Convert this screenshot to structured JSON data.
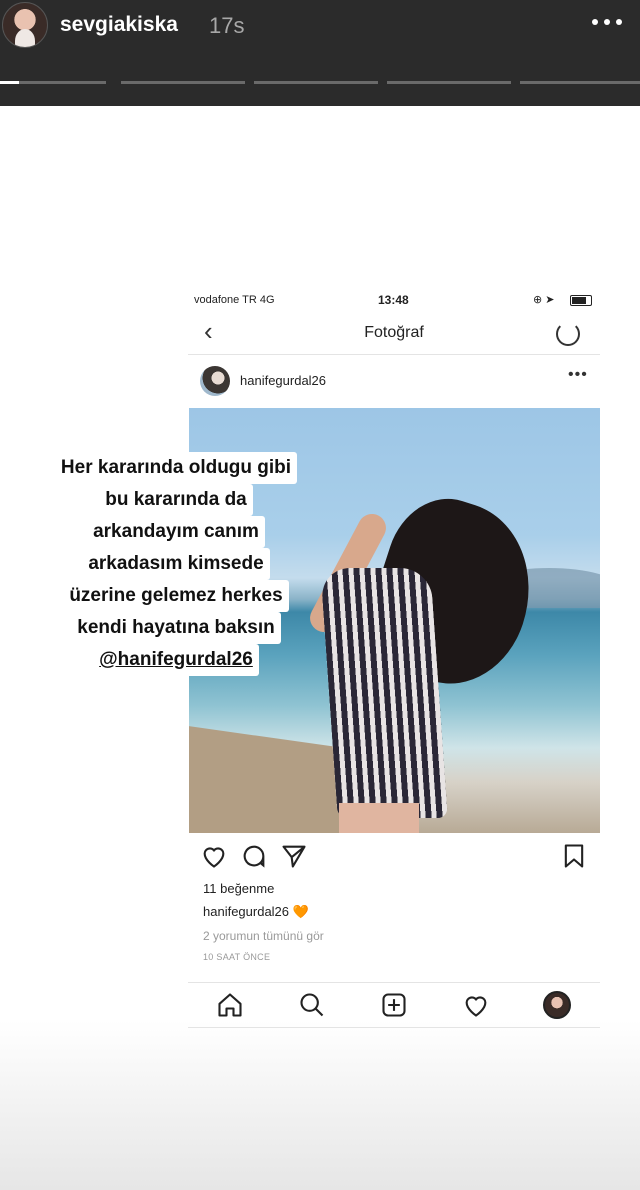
{
  "story": {
    "username": "sevgiakiska",
    "time": "17s",
    "progress_segments": [
      {
        "fill": 0.18
      },
      {
        "fill": 0
      },
      {
        "fill": 0
      },
      {
        "fill": 0
      },
      {
        "fill": 0
      }
    ]
  },
  "status_bar": {
    "carrier": "vodafone TR  4G",
    "clock": "13:48",
    "icons": "⊕ ➤"
  },
  "ig_nav": {
    "back": "‹",
    "title": "Fotoğraf"
  },
  "post": {
    "username": "hanifegurdal26",
    "more": "•••",
    "caption_lines": [
      "Her kararında oldugu gibi",
      "bu kararında da",
      "arkandayım canım",
      "arkadasım kimsede",
      "üzerine gelemez herkes",
      "kendi hayatına baksın"
    ],
    "mention": "@hanifegurdal26",
    "likes": "11 beğenme",
    "owner": "hanifegurdal26",
    "owner_emoji": "🧡",
    "comments_link": "2 yorumun tümünü gör",
    "time_ago": "10 SAAT ÖNCE"
  },
  "icons": {
    "heart": "heart-icon",
    "comment": "comment-icon",
    "share": "send-icon",
    "save": "bookmark-icon",
    "home": "home-icon",
    "search": "search-icon",
    "add": "add-post-icon",
    "activity": "heart-outline-icon",
    "profile": "profile-avatar"
  },
  "colors": {
    "story_bg": "#2b2b2b",
    "accent_heart": "#f19a2a"
  }
}
